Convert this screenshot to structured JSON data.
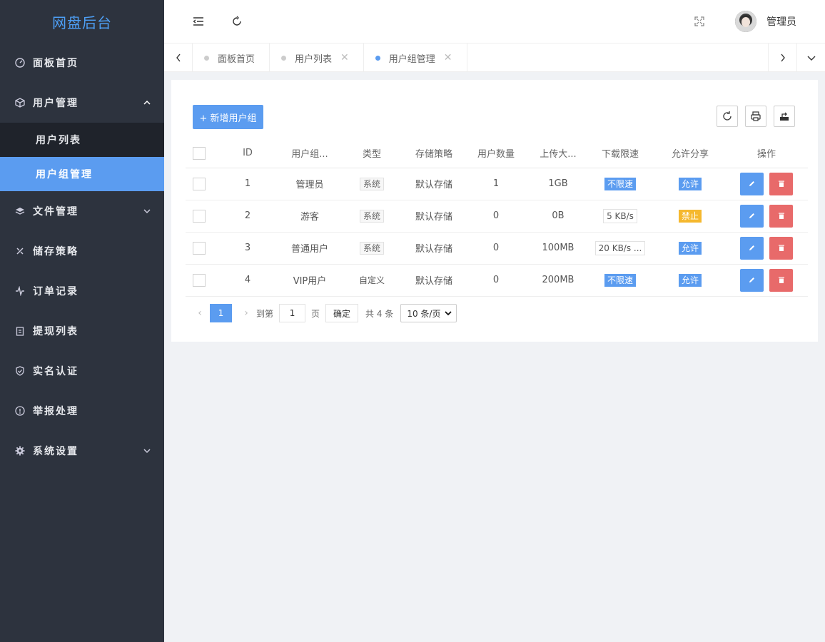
{
  "app": {
    "logo": "网盘后台"
  },
  "sidebar": {
    "items": [
      {
        "label": "面板首页",
        "icon": "dashboard-icon"
      },
      {
        "label": "用户管理",
        "icon": "cube-icon",
        "expanded": true
      },
      {
        "label": "文件管理",
        "icon": "layers-icon"
      },
      {
        "label": "储存策略",
        "icon": "strategy-icon"
      },
      {
        "label": "订单记录",
        "icon": "pulse-icon"
      },
      {
        "label": "提现列表",
        "icon": "clipboard-icon"
      },
      {
        "label": "实名认证",
        "icon": "shield-check-icon"
      },
      {
        "label": "举报处理",
        "icon": "alert-circle-icon"
      },
      {
        "label": "系统设置",
        "icon": "gear-icon"
      }
    ],
    "submenu": [
      {
        "label": "用户列表"
      },
      {
        "label": "用户组管理",
        "active": true
      }
    ]
  },
  "header": {
    "username": "管理员"
  },
  "tabs": [
    {
      "label": "面板首页"
    },
    {
      "label": "用户列表"
    },
    {
      "label": "用户组管理",
      "active": true
    }
  ],
  "toolbar": {
    "add_label": "+ 新增用户组"
  },
  "table": {
    "columns": [
      "ID",
      "用户组...",
      "类型",
      "存储策略",
      "用户数量",
      "上传大...",
      "下载限速",
      "允许分享",
      "操作"
    ],
    "rows": [
      {
        "id": "1",
        "name": "管理员",
        "type": "系统",
        "policy": "默认存储",
        "count": "1",
        "upload": "1GB",
        "speed": "不限速",
        "share": "允许"
      },
      {
        "id": "2",
        "name": "游客",
        "type": "系统",
        "policy": "默认存储",
        "count": "0",
        "upload": "0B",
        "speed": "5 KB/s",
        "share": "禁止"
      },
      {
        "id": "3",
        "name": "普通用户",
        "type": "系统",
        "policy": "默认存储",
        "count": "0",
        "upload": "100MB",
        "speed": "20 KB/s  ...",
        "share": "允许"
      },
      {
        "id": "4",
        "name": "VIP用户",
        "type": "自定义",
        "policy": "默认存储",
        "count": "0",
        "upload": "200MB",
        "speed": "不限速",
        "share": "允许"
      }
    ]
  },
  "pagination": {
    "current": "1",
    "goto_prefix": "到第",
    "goto_value": "1",
    "goto_suffix": "页",
    "confirm": "确定",
    "total": "共 4 条",
    "page_size": "10 条/页"
  },
  "colors": {
    "accent": "#5b9cf0",
    "danger": "#e86a6a",
    "warning": "#f5b82e",
    "sidebar": "#2d333e"
  }
}
